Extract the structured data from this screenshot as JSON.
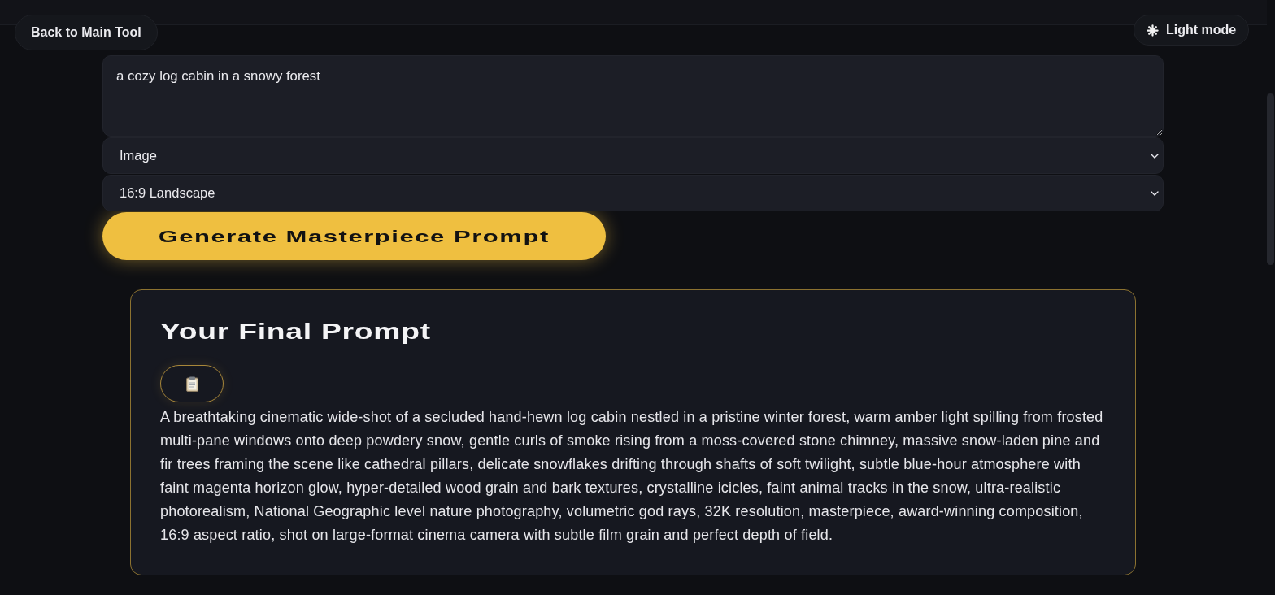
{
  "header": {
    "back_button": "Back to Main Tool",
    "theme_toggle": "Light mode"
  },
  "form": {
    "prompt_input": {
      "value": "a cozy log cabin in a snowy forest"
    },
    "selects": [
      {
        "value": "Image"
      },
      {
        "value": "16:9 Landscape"
      }
    ],
    "generate_button": "Generate Masterpiece Prompt"
  },
  "result": {
    "title": "Your Final Prompt",
    "prompt_text": "A breathtaking cinematic wide-shot of a secluded hand-hewn log cabin nestled in a pristine winter forest, warm amber light spilling from frosted multi-pane windows onto deep powdery snow, gentle curls of smoke rising from a moss-covered stone chimney, massive snow-laden pine and fir trees framing the scene like cathedral pillars, delicate snowflakes drifting through shafts of soft twilight, subtle blue-hour atmosphere with faint magenta horizon glow, hyper-detailed wood grain and bark textures, crystalline icicles, faint animal tracks in the snow, ultra-realistic photorealism, National Geographic level nature photography, volumetric god rays, 32K resolution, masterpiece, award-winning composition, 16:9 aspect ratio, shot on large-format cinema camera with subtle film grain and perfect depth of field."
  }
}
